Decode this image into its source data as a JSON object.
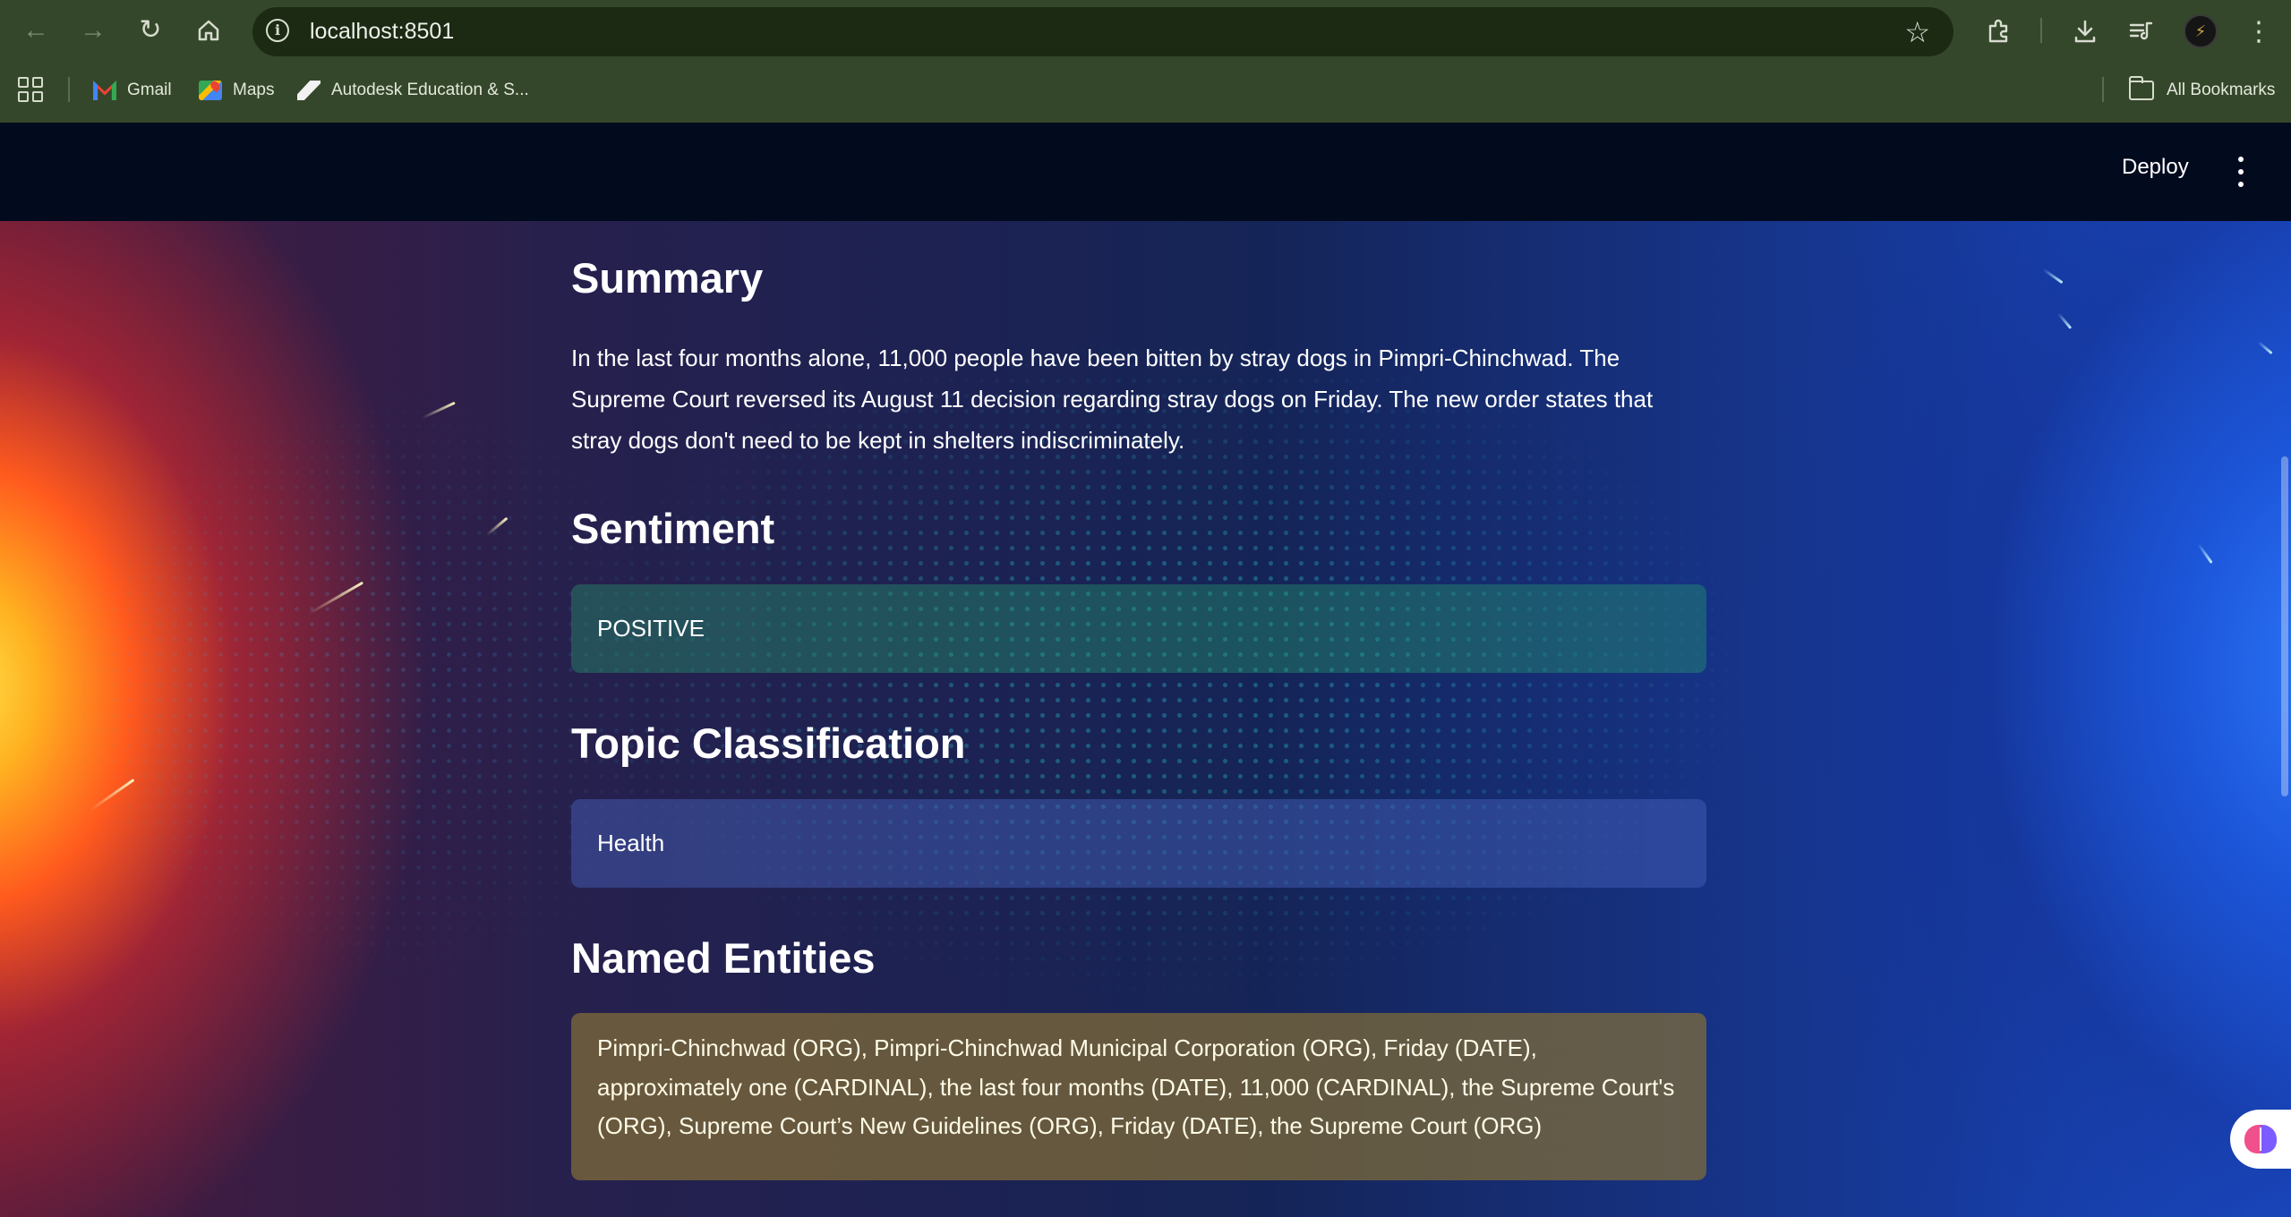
{
  "browser": {
    "url": "localhost:8501",
    "bookmarks": [
      {
        "label": "Gmail",
        "icon": "gmail-icon"
      },
      {
        "label": "Maps",
        "icon": "maps-icon"
      },
      {
        "label": "Autodesk Education & S...",
        "icon": "autodesk-icon"
      }
    ],
    "all_bookmarks_label": "All Bookmarks"
  },
  "app_header": {
    "deploy_label": "Deploy"
  },
  "main": {
    "summary": {
      "title": "Summary",
      "text": "In the last four months alone, 11,000 people have been bitten by stray dogs in Pimpri-Chinchwad. The Supreme Court reversed its August 11 decision regarding stray dogs on Friday. The new order states that stray dogs don't need to be kept in shelters indiscriminately."
    },
    "sentiment": {
      "title": "Sentiment",
      "value": "POSITIVE",
      "color": "#28a06e"
    },
    "topic": {
      "title": "Topic Classification",
      "value": "Health",
      "color": "#4664be"
    },
    "entities": {
      "title": "Named Entities",
      "value": "Pimpri-Chinchwad (ORG), Pimpri-Chinchwad Municipal Corporation (ORG), Friday (DATE), approximately one (CARDINAL), the last four months (DATE), 11,000 (CARDINAL), the Supreme Court's (ORG), Supreme Court’s New Guidelines (ORG), Friday (DATE), the Supreme Court (ORG)",
      "color": "#826e37"
    }
  }
}
